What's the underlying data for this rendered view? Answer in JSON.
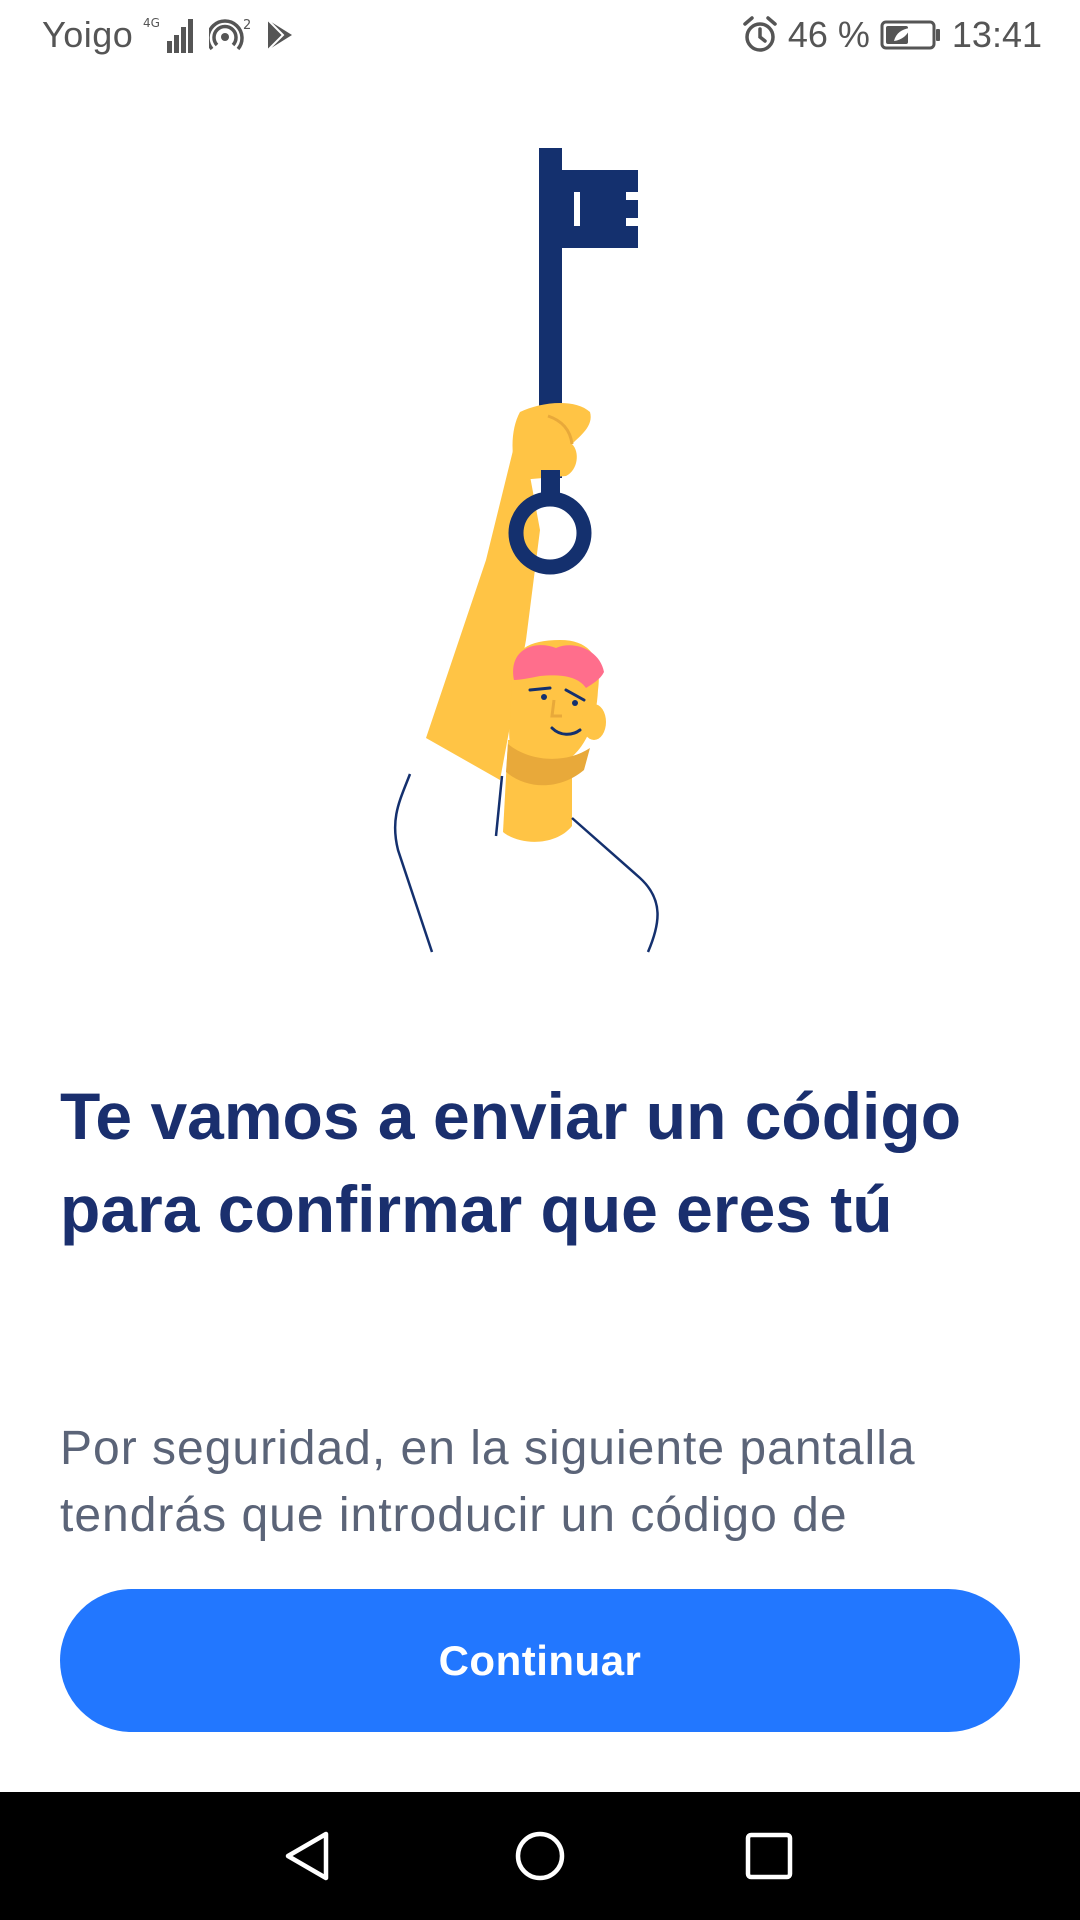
{
  "status_bar": {
    "carrier": "Yoigo",
    "network_type": "4G",
    "hotspot_count": "2",
    "battery_percent": "46 %",
    "time": "13:41",
    "icons": [
      "signal-icon",
      "hotspot-icon",
      "play-store-icon",
      "alarm-icon",
      "battery-icon"
    ]
  },
  "screen": {
    "title": "Te vamos a enviar un código para confirmar que eres tú",
    "description": "Por seguridad, en la siguiente pantalla tendrás que introducir un código de",
    "continue_button_label": "Continuar"
  },
  "nav_bar": {
    "icons": [
      "back-icon",
      "home-icon",
      "recents-icon"
    ]
  },
  "colors": {
    "title": "#1a2f6e",
    "body": "#5b6478",
    "button": "#2277ff",
    "key": "#14306e",
    "arm": "#ffc445",
    "hair": "#ff6e8c"
  }
}
